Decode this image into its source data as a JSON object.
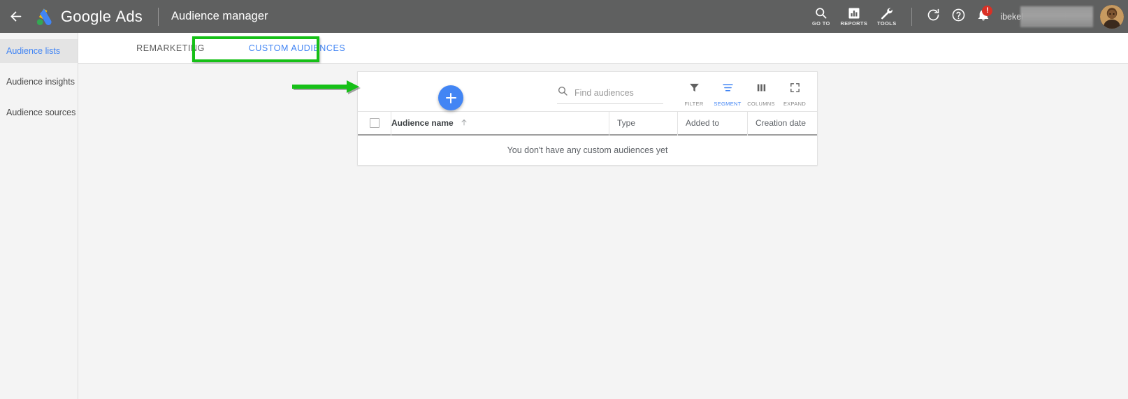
{
  "header": {
    "back_icon": "arrow-left-icon",
    "brand": "Google",
    "brand_suffix": "Ads",
    "page_title": "Audience manager",
    "tools": [
      {
        "label": "GO TO",
        "icon": "search-icon"
      },
      {
        "label": "REPORTS",
        "icon": "bar-chart-icon"
      },
      {
        "label": "TOOLS",
        "icon": "wrench-icon"
      }
    ],
    "refresh_icon": "refresh-icon",
    "help_icon": "help-circle-icon",
    "notifications_icon": "bell-icon",
    "notification_badge": "!",
    "user_name": "ibekel",
    "avatar": "user-avatar",
    "bg_color": "#5f6060"
  },
  "sidebar": {
    "items": [
      {
        "label": "Audience lists",
        "active": true
      },
      {
        "label": "Audience insights",
        "active": false
      },
      {
        "label": "Audience sources",
        "active": false
      }
    ]
  },
  "tabs": {
    "items": [
      {
        "label": "REMARKETING",
        "active": false
      },
      {
        "label": "CUSTOM AUDIENCES",
        "active": true
      }
    ],
    "highlight_color": "#16c017",
    "active_color": "#4285f4"
  },
  "toolbar": {
    "add_button_label": "+",
    "search_placeholder": "Find audiences",
    "search_value": "",
    "search_icon": "search-icon",
    "buttons": [
      {
        "label": "FILTER",
        "icon": "funnel-icon",
        "active": false
      },
      {
        "label": "SEGMENT",
        "icon": "segment-lines-icon",
        "active": true
      },
      {
        "label": "COLUMNS",
        "icon": "columns-icon",
        "active": false
      },
      {
        "label": "EXPAND",
        "icon": "expand-corners-icon",
        "active": false
      }
    ]
  },
  "table": {
    "columns": [
      {
        "label": "Audience name",
        "sorted": true,
        "sort_dir": "asc"
      },
      {
        "label": "Type"
      },
      {
        "label": "Added to"
      },
      {
        "label": "Creation date"
      }
    ],
    "rows": [],
    "empty_message": "You don't have any custom audiences yet"
  },
  "annotations": {
    "arrow_color": "#16c017",
    "arrow_target": "add-audience-fab"
  }
}
